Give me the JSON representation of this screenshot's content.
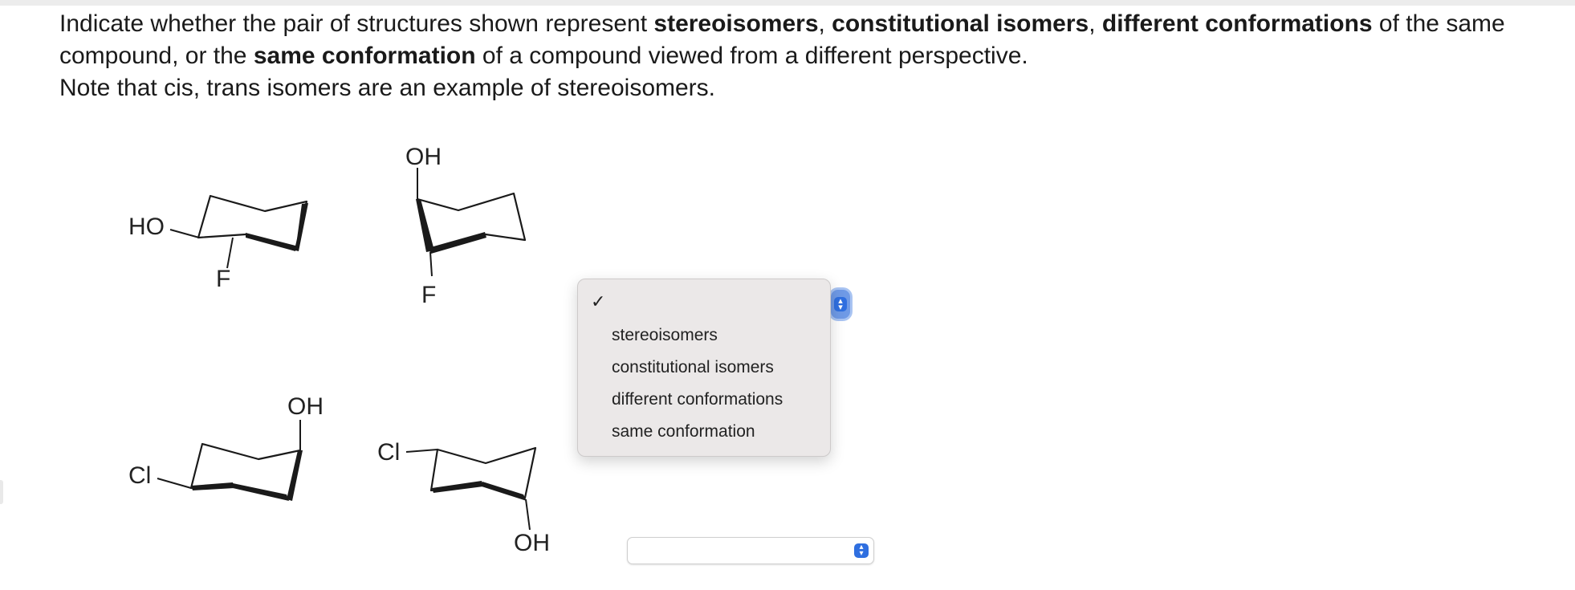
{
  "prompt": {
    "l1_a": "Indicate whether the pair of structures shown represent ",
    "l1_b1": "stereoisomers",
    "l1_c1": ", ",
    "l1_b2": "constitutional isomers",
    "l1_c2": ", ",
    "l1_b3": "different conformations",
    "l1_d": " of the same compound, or the ",
    "l1_b4": "same conformation",
    "l1_e": " of a compound viewed from a different perspective.",
    "line2": "Note that cis, trans isomers are an example of stereoisomers."
  },
  "structures": {
    "pair1_left": {
      "sub1": "HO",
      "sub2": "F"
    },
    "pair1_right": {
      "sub1": "OH",
      "sub2": "F"
    },
    "pair2_left": {
      "sub1": "Cl",
      "sub2": "OH"
    },
    "pair2_right": {
      "sub1": "Cl",
      "sub2": "OH"
    }
  },
  "dropdown1": {
    "selected_mark": "✓",
    "options": [
      "stereoisomers",
      "constitutional isomers",
      "different conformations",
      "same conformation"
    ]
  },
  "dropdown2": {
    "value": ""
  },
  "colors": {
    "accent": "#2f6fe0",
    "menu_bg": "#ebe8e8"
  },
  "icons": {
    "check": "checkmark-icon",
    "stepper": "up-down-chevron-icon"
  }
}
